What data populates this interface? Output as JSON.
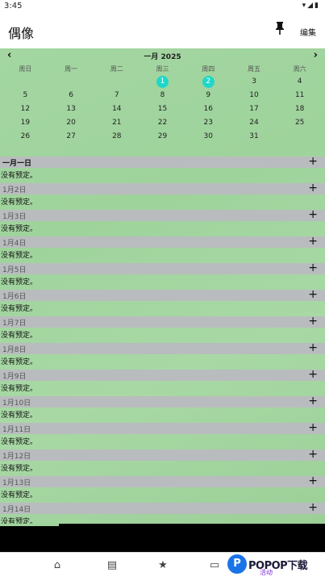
{
  "status_bar": {
    "time": "3:45",
    "icons": "▾◢▮"
  },
  "app_bar": {
    "title": "偶像",
    "pin_icon": "pin-icon",
    "edit_label": "编集"
  },
  "calendar": {
    "month_label": "一月 2025",
    "prev_icon": "‹",
    "next_icon": "›",
    "weekdays": [
      "周日",
      "周一",
      "周二",
      "周三",
      "周四",
      "周五",
      "周六"
    ],
    "today_color": "#1fd7c8",
    "weeks": [
      [
        "",
        "",
        "",
        "1",
        "2",
        "3",
        "4"
      ],
      [
        "5",
        "6",
        "7",
        "8",
        "9",
        "10",
        "11"
      ],
      [
        "12",
        "13",
        "14",
        "15",
        "16",
        "17",
        "18"
      ],
      [
        "19",
        "20",
        "21",
        "22",
        "23",
        "24",
        "25"
      ],
      [
        "26",
        "27",
        "28",
        "29",
        "30",
        "31",
        ""
      ]
    ],
    "highlighted": [
      "1",
      "2"
    ]
  },
  "agenda": {
    "add_icon": "+",
    "days": [
      {
        "label": "一月一日",
        "note": "没有预定。"
      },
      {
        "label": "1月2日",
        "note": "没有预定。"
      },
      {
        "label": "1月3日",
        "note": "没有预定。"
      },
      {
        "label": "1月4日",
        "note": "没有预定。"
      },
      {
        "label": "1月5日",
        "note": "没有预定。"
      },
      {
        "label": "1月6日",
        "note": "没有预定。"
      },
      {
        "label": "1月7日",
        "note": "没有预定。"
      },
      {
        "label": "1月8日",
        "note": "没有预定。"
      },
      {
        "label": "1月9日",
        "note": "没有预定。"
      },
      {
        "label": "1月10日",
        "note": "没有预定。"
      },
      {
        "label": "1月11日",
        "note": "没有预定。"
      },
      {
        "label": "1月12日",
        "note": "没有预定。"
      },
      {
        "label": "1月13日",
        "note": "没有预定。"
      },
      {
        "label": "1月14日",
        "note": "没有预定。"
      }
    ]
  },
  "bottom_nav": {
    "items": [
      {
        "name": "home-icon",
        "glyph": "⌂"
      },
      {
        "name": "book-icon",
        "glyph": "▤"
      },
      {
        "name": "star-icon",
        "glyph": "★"
      },
      {
        "name": "card-icon",
        "glyph": "▭"
      }
    ]
  },
  "watermark": {
    "logo_letter": "P",
    "text": "POPOP下载",
    "sub": "活动"
  }
}
